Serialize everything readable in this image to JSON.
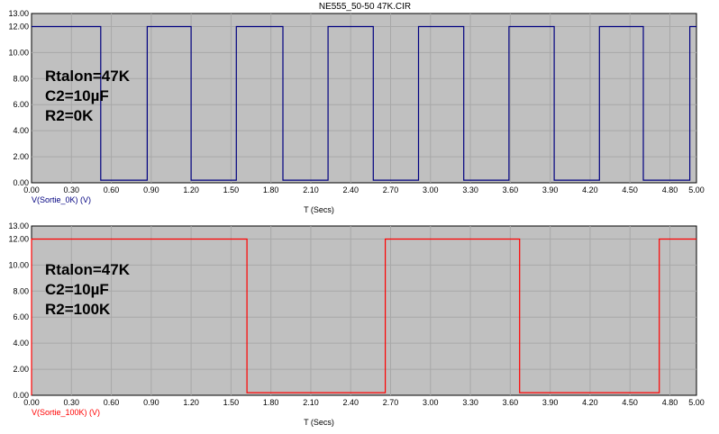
{
  "window": {
    "title": "NE555_50-50 47K.CIR"
  },
  "colors": {
    "background": "#c0c0c0",
    "grid": "#a8a8a8",
    "series_top": "#000080",
    "series_bottom": "#ff0000"
  },
  "panels": {
    "top": {
      "annotation": [
        "Rtalon=47K",
        "C2=10µF",
        "R2=0K"
      ]
    },
    "bottom": {
      "annotation": [
        "Rtalon=47K",
        "C2=10µF",
        "R2=100K"
      ]
    }
  },
  "chart_data": [
    {
      "type": "line",
      "title": "NE555_50-50 47K.CIR",
      "xlabel": "T (Secs)",
      "ylabel": "",
      "xlim": [
        0,
        5
      ],
      "ylim": [
        0,
        13
      ],
      "x_ticks": [
        "0.00",
        "0.30",
        "0.60",
        "0.90",
        "1.20",
        "1.50",
        "1.80",
        "2.10",
        "2.40",
        "2.70",
        "3.00",
        "3.30",
        "3.60",
        "3.90",
        "4.20",
        "4.50",
        "4.80",
        "5.00"
      ],
      "y_ticks": [
        "0.00",
        "2.00",
        "4.00",
        "6.00",
        "8.00",
        "10.00",
        "12.00",
        "13.00"
      ],
      "grid": true,
      "series": [
        {
          "name": "V(Sortie_0K) (V)",
          "color": "#000080",
          "x": [
            0,
            0.52,
            0.52,
            0.87,
            0.87,
            1.2,
            1.2,
            1.54,
            1.54,
            1.89,
            1.89,
            2.23,
            2.23,
            2.57,
            2.57,
            2.91,
            2.91,
            3.25,
            3.25,
            3.59,
            3.59,
            3.93,
            3.93,
            4.27,
            4.27,
            4.6,
            4.6,
            4.95,
            4.95,
            5.0
          ],
          "y": [
            12,
            12,
            0.2,
            0.2,
            12,
            12,
            0.2,
            0.2,
            12,
            12,
            0.2,
            0.2,
            12,
            12,
            0.2,
            0.2,
            12,
            12,
            0.2,
            0.2,
            12,
            12,
            0.2,
            0.2,
            12,
            12,
            0.2,
            0.2,
            12,
            12
          ]
        }
      ]
    },
    {
      "type": "line",
      "title": "",
      "xlabel": "T (Secs)",
      "ylabel": "",
      "xlim": [
        0,
        5
      ],
      "ylim": [
        0,
        13
      ],
      "x_ticks": [
        "0.00",
        "0.30",
        "0.60",
        "0.90",
        "1.20",
        "1.50",
        "1.80",
        "2.10",
        "2.40",
        "2.70",
        "3.00",
        "3.30",
        "3.60",
        "3.90",
        "4.20",
        "4.50",
        "4.80",
        "5.00"
      ],
      "y_ticks": [
        "0.00",
        "2.00",
        "4.00",
        "6.00",
        "8.00",
        "10.00",
        "12.00",
        "13.00"
      ],
      "grid": true,
      "series": [
        {
          "name": "V(Sortie_100K) (V)",
          "color": "#ff0000",
          "x": [
            0,
            0,
            1.62,
            1.62,
            2.66,
            2.66,
            3.67,
            3.67,
            4.72,
            4.72,
            5.0
          ],
          "y": [
            0,
            12,
            12,
            0.2,
            0.2,
            12,
            12,
            0.2,
            0.2,
            12,
            12
          ]
        }
      ]
    }
  ]
}
